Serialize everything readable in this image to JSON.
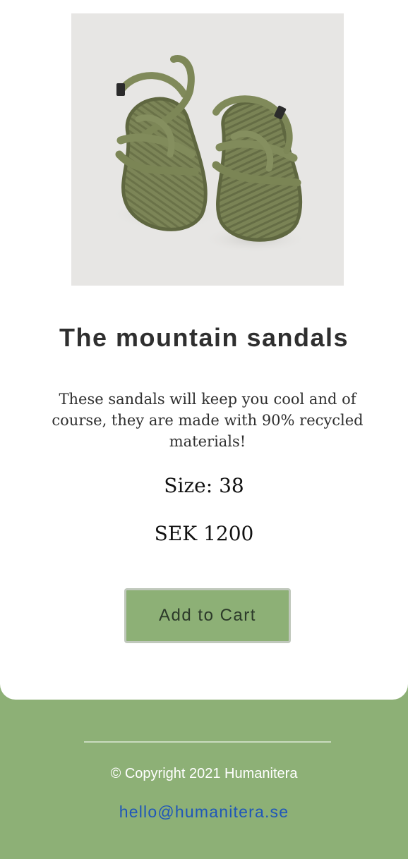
{
  "product": {
    "image_icon": "rope-sandals-photo",
    "title": "The mountain sandals",
    "description": "These sandals will keep you cool and of course, they are made with 90% recycled materials!",
    "size": "Size: 38",
    "price": "SEK 1200",
    "add_to_cart_label": "Add to Cart"
  },
  "footer": {
    "copyright": "© Copyright 2021 Humanitera",
    "email": "hello@humanitera.se"
  },
  "colors": {
    "accent_green": "#8db076",
    "link_blue": "#1f56b9",
    "text_dark": "#2f2f2f",
    "sandal_olive": "#7c8557",
    "image_bg": "#e7e6e4"
  }
}
